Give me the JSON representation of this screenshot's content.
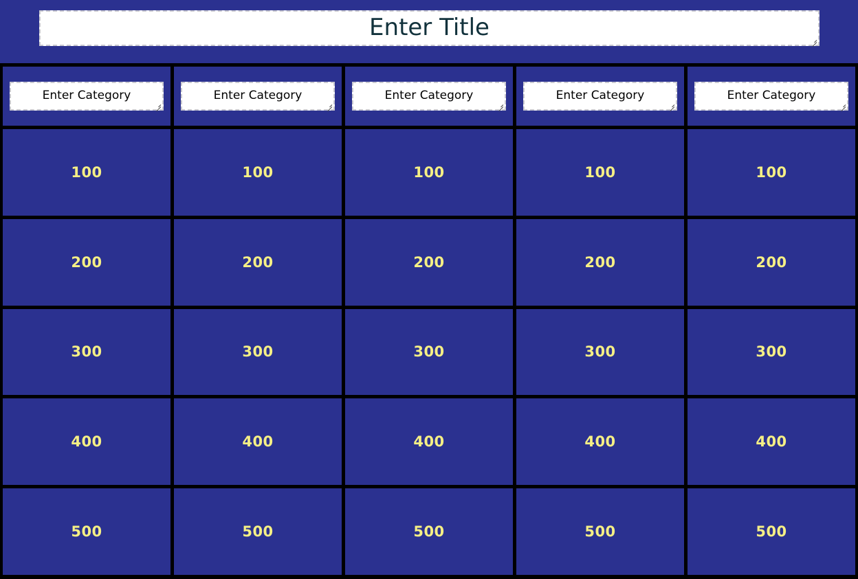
{
  "board": {
    "background_color": "#2b3190",
    "cell_color": "#2b3190",
    "grid_line_color": "#000000",
    "value_text_color": "#f5ef85",
    "title_text_color": "#12323c",
    "field_background": "#ffffff",
    "field_border_color": "#c8c8cf"
  },
  "title": {
    "value": "Enter Title",
    "placeholder": "Enter Title"
  },
  "categories": [
    {
      "value": "Enter Category",
      "placeholder": "Enter Category"
    },
    {
      "value": "Enter Category",
      "placeholder": "Enter Category"
    },
    {
      "value": "Enter Category",
      "placeholder": "Enter Category"
    },
    {
      "value": "Enter Category",
      "placeholder": "Enter Category"
    },
    {
      "value": "Enter Category",
      "placeholder": "Enter Category"
    }
  ],
  "rows": [
    {
      "points": "100",
      "cells": [
        "100",
        "100",
        "100",
        "100",
        "100"
      ]
    },
    {
      "points": "200",
      "cells": [
        "200",
        "200",
        "200",
        "200",
        "200"
      ]
    },
    {
      "points": "300",
      "cells": [
        "300",
        "300",
        "300",
        "300",
        "300"
      ]
    },
    {
      "points": "400",
      "cells": [
        "400",
        "400",
        "400",
        "400",
        "400"
      ]
    },
    {
      "points": "500",
      "cells": [
        "500",
        "500",
        "500",
        "500",
        "500"
      ]
    }
  ]
}
